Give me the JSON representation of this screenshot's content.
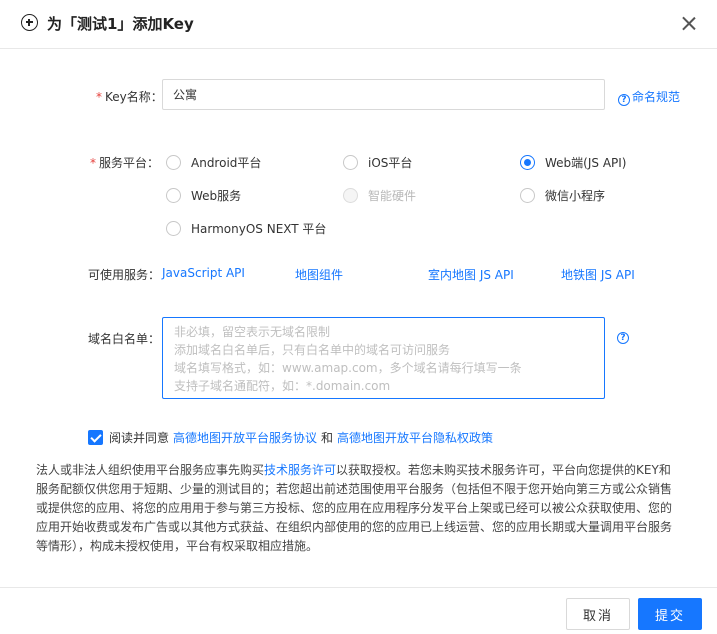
{
  "header": {
    "title": "为「测试1」添加Key",
    "icon": "plus-circle-icon",
    "close_icon": "close-icon"
  },
  "form": {
    "key_name": {
      "required_mark": "*",
      "label": "Key名称：",
      "value": "公寓",
      "help_text": "命名规范"
    },
    "platform": {
      "required_mark": "*",
      "label": "服务平台：",
      "options": [
        {
          "label": "Android平台",
          "checked": false,
          "disabled": false
        },
        {
          "label": "iOS平台",
          "checked": false,
          "disabled": false
        },
        {
          "label": "Web端(JS API)",
          "checked": true,
          "disabled": false
        },
        {
          "label": "Web服务",
          "checked": false,
          "disabled": false
        },
        {
          "label": "智能硬件",
          "checked": false,
          "disabled": true
        },
        {
          "label": "微信小程序",
          "checked": false,
          "disabled": false
        },
        {
          "label": "HarmonyOS NEXT 平台",
          "checked": false,
          "disabled": false
        }
      ]
    },
    "services": {
      "label": "可使用服务：",
      "items": [
        "JavaScript API",
        "地图组件",
        "室内地图 JS API",
        "地铁图 JS API"
      ]
    },
    "domain_whitelist": {
      "label": "域名白名单：",
      "value": "",
      "placeholder_lines": [
        "非必填，留空表示无域名限制",
        "添加域名白名单后，只有白名单中的域名可访问服务",
        "域名填写格式，如：www.amap.com，多个域名请每行填写一条",
        "支持子域名通配符，如：*.domain.com"
      ]
    },
    "agreement": {
      "checked": true,
      "prefix": "阅读并同意",
      "link1": "高德地图开放平台服务协议",
      "and": "和",
      "link2": "高德地图开放平台隐私权政策"
    }
  },
  "notice": {
    "part1": "法人或非法人组织使用平台服务应事先购买",
    "link": "技术服务许可",
    "part2": "以获取授权。若您未购买技术服务许可，平台向您提供的KEY和服务配额仅供您用于短期、少量的测试目的；若您超出前述范围使用平台服务（包括但不限于您开始向第三方或公众销售或提供您的应用、将您的应用用于参与第三方投标、您的应用在应用程序分发平台上架或已经可以被公众获取使用、您的应用开始收费或发布广告或以其他方式获益、在组织内部使用的您的应用已上线运营、您的应用长期或大量调用平台服务等情形），构成未授权使用，平台有权采取相应措施。"
  },
  "footer": {
    "cancel_label": "取消",
    "submit_label": "提交"
  },
  "colors": {
    "accent": "#1677ff",
    "required": "#e5413c"
  }
}
